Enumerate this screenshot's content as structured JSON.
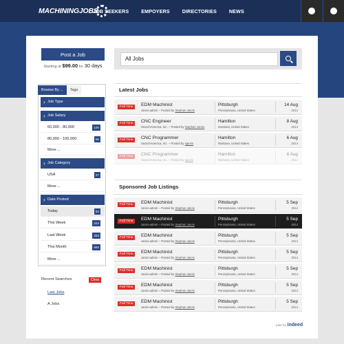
{
  "header": {
    "logo_text": "MACHININGJOBS",
    "nav": [
      "JOB SEEKERS",
      "EMPOYERS",
      "DIRECTORIES",
      "NEWS"
    ],
    "icons": [
      "user-settings-icon",
      "user-profile-icon"
    ]
  },
  "post": {
    "button_label": "Post a Job",
    "starting_at": "Starting at",
    "price": "$99.00",
    "for": "for",
    "duration": "30 days"
  },
  "search": {
    "value": "All Jobs"
  },
  "sidebar": {
    "tabs": [
      "Browse By ...",
      "Tags"
    ],
    "sections": [
      {
        "head": "Job Type",
        "rows": []
      },
      {
        "head": "Job Salary",
        "rows": [
          {
            "label": "60,000 - 80,000",
            "count": "100"
          },
          {
            "label": "80,000 - 100,000",
            "count": "56"
          },
          {
            "label": "More ...",
            "count": ""
          }
        ]
      },
      {
        "head": "Job Category",
        "rows": [
          {
            "label": "USA",
            "count": "27"
          },
          {
            "label": "More ...",
            "count": ""
          }
        ]
      },
      {
        "head": "Date Posted",
        "rows": [
          {
            "label": "Today",
            "count": "53"
          },
          {
            "label": "This Week",
            "count": "224"
          },
          {
            "label": "Last Week",
            "count": "253"
          },
          {
            "label": "This Month",
            "count": "650"
          },
          {
            "label": "More ...",
            "count": ""
          }
        ]
      }
    ],
    "recent": {
      "title": "Recent Searches",
      "clear": "Clear",
      "items": [
        "Law Jobs",
        "A Jobs"
      ]
    }
  },
  "latest": {
    "title": "Latest Jobs",
    "jobs": [
      {
        "badge": "Full Time",
        "title": "EDM Machinist",
        "company": "Jarvis-admin",
        "posted_by": "Posted by",
        "poster": "Stephan Jarvis",
        "city": "Pittsburgh",
        "state": "Pennsylvania, United States",
        "day": "14 Aug",
        "year": "2014"
      },
      {
        "badge": "Full Time",
        "title": "CNC Engineer",
        "company": "SearchAmerica, Inc.",
        "posted_by": "Posted by",
        "poster": "Stephan Jarvis",
        "city": "Hamilton",
        "state": "Montana, United States",
        "day": "8 Aug",
        "year": "2014"
      },
      {
        "badge": "Full Time",
        "title": "CNC Programmer",
        "company": "SearchAmerica, Inc.",
        "posted_by": "Posted by",
        "poster": "sjarvis",
        "city": "Hamilton",
        "state": "Montana, United States",
        "day": "6 Aug",
        "year": "2014"
      },
      {
        "badge": "Full Time",
        "title": "CNC Programmer",
        "company": "SearchAmerica, Inc.",
        "posted_by": "Posted by",
        "poster": "sjarvis",
        "city": "Hamilton",
        "state": "Montana, United States",
        "day": "6 Aug",
        "year": "2014"
      }
    ]
  },
  "sponsored": {
    "title": "Sponsored Job Listings",
    "jobs": [
      {
        "badge": "Full Time",
        "title": "EDM Machinist",
        "company": "Jarvis-admin",
        "posted_by": "Posted by",
        "poster": "Stephan Jarvis",
        "city": "Pittsburgh",
        "state": "Pennsylvania, United States",
        "day": "5 Sep",
        "year": "2014"
      },
      {
        "badge": "Full Time",
        "title": "EDM Machinist",
        "company": "Jarvis-admin",
        "posted_by": "Posted by",
        "poster": "Stephan Jarvis",
        "city": "Pittsburgh",
        "state": "Pennsylvania, United States",
        "day": "5 Sep",
        "year": "2014"
      },
      {
        "badge": "Full Time",
        "title": "EDM Machinist",
        "company": "Jarvis-admin",
        "posted_by": "Posted by",
        "poster": "Stephan Jarvis",
        "city": "Pittsburgh",
        "state": "Pennsylvania, United States",
        "day": "5 Sep",
        "year": "2014"
      },
      {
        "badge": "Full Time",
        "title": "EDM Machinist",
        "company": "Jarvis-admin",
        "posted_by": "Posted by",
        "poster": "Stephan Jarvis",
        "city": "Pittsburgh",
        "state": "Pennsylvania, United States",
        "day": "5 Sep",
        "year": "2014"
      },
      {
        "badge": "Full Time",
        "title": "EDM Machinist",
        "company": "Jarvis-admin",
        "posted_by": "Posted by",
        "poster": "Stephan Jarvis",
        "city": "Pittsburgh",
        "state": "Pennsylvania, United States",
        "day": "5 Sep",
        "year": "2014"
      },
      {
        "badge": "Full Time",
        "title": "EDM Machinist",
        "company": "Jarvis-admin",
        "posted_by": "Posted by",
        "poster": "Stephan Jarvis",
        "city": "Pittsburgh",
        "state": "Pennsylvania, United States",
        "day": "5 Sep",
        "year": "2014"
      },
      {
        "badge": "Full Time",
        "title": "EDM Machinist",
        "company": "Jarvis-admin",
        "posted_by": "Posted by",
        "poster": "Stephan Jarvis",
        "city": "Pittsburgh",
        "state": "Pennsylvania, United States",
        "day": "5 Sep",
        "year": "2014"
      }
    ]
  },
  "footer": {
    "jobs_by": "jobs by",
    "brand": "indeed"
  },
  "colors": {
    "nav_bg": "#1b2f57",
    "hero_bg": "#25457f",
    "accent": "#2b4a86",
    "badge": "#d9302a"
  }
}
